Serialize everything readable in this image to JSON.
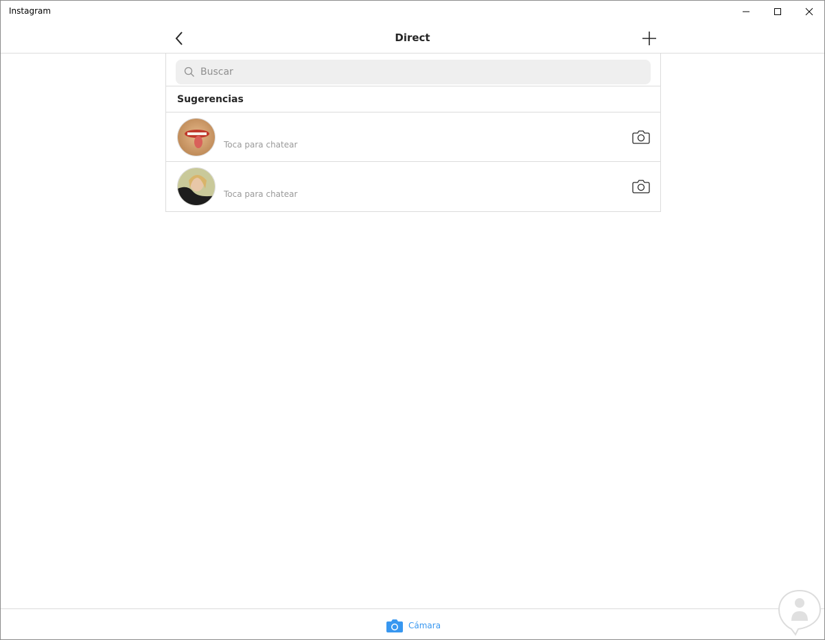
{
  "window": {
    "title": "Instagram",
    "controls": {
      "minimize_icon": "minimize-icon",
      "maximize_icon": "maximize-icon",
      "close_icon": "close-icon"
    }
  },
  "header": {
    "title": "Direct",
    "back_icon": "chevron-left-icon",
    "add_icon": "plus-icon"
  },
  "search": {
    "placeholder": "Buscar",
    "value": ""
  },
  "suggestions": {
    "heading": "Sugerencias",
    "items": [
      {
        "subtitle": "Toca para chatear"
      },
      {
        "subtitle": "Toca para chatear"
      }
    ]
  },
  "bottom": {
    "camera_label": "Cámara"
  },
  "colors": {
    "accent": "#3897f0",
    "border": "#dbdbdb",
    "search_bg": "#efefef",
    "muted_text": "#999999"
  }
}
